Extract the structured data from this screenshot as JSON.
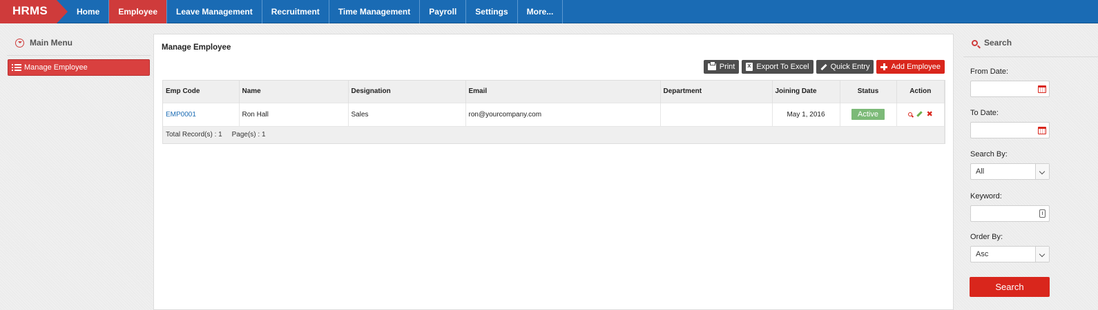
{
  "brand": "HRMS",
  "nav": [
    {
      "label": "Home",
      "active": false
    },
    {
      "label": "Employee",
      "active": true
    },
    {
      "label": "Leave Management",
      "active": false
    },
    {
      "label": "Recruitment",
      "active": false
    },
    {
      "label": "Time Management",
      "active": false
    },
    {
      "label": "Payroll",
      "active": false
    },
    {
      "label": "Settings",
      "active": false
    },
    {
      "label": "More...",
      "active": false
    }
  ],
  "sidebar": {
    "heading": "Main Menu",
    "items": [
      {
        "label": "Manage Employee"
      }
    ]
  },
  "main": {
    "title": "Manage Employee",
    "toolbar": {
      "print": "Print",
      "export": "Export To Excel",
      "quick_entry": "Quick Entry",
      "add_employee": "Add Employee"
    },
    "table": {
      "columns": [
        "Emp Code",
        "Name",
        "Designation",
        "Email",
        "Department",
        "Joining Date",
        "Status",
        "Action"
      ],
      "rows": [
        {
          "emp_code": "EMP0001",
          "name": "Ron Hall",
          "designation": "Sales",
          "email": "ron@yourcompany.com",
          "department": "",
          "joining_date": "May 1, 2016",
          "status": "Active"
        }
      ],
      "footer": {
        "total_label": "Total Record(s) :",
        "total_value": "1",
        "pages_label": "Page(s) :",
        "pages_value": "1"
      }
    }
  },
  "search": {
    "heading": "Search",
    "from_date_label": "From Date:",
    "from_date_value": "",
    "to_date_label": "To Date:",
    "to_date_value": "",
    "search_by_label": "Search By:",
    "search_by_value": "All",
    "keyword_label": "Keyword:",
    "keyword_value": "",
    "order_by_label": "Order By:",
    "order_by_value": "Asc",
    "button": "Search"
  },
  "colors": {
    "nav_blue": "#1a6bb4",
    "brand_red": "#cf3b3b",
    "action_red": "#d9261c",
    "status_green": "#7cba78"
  }
}
